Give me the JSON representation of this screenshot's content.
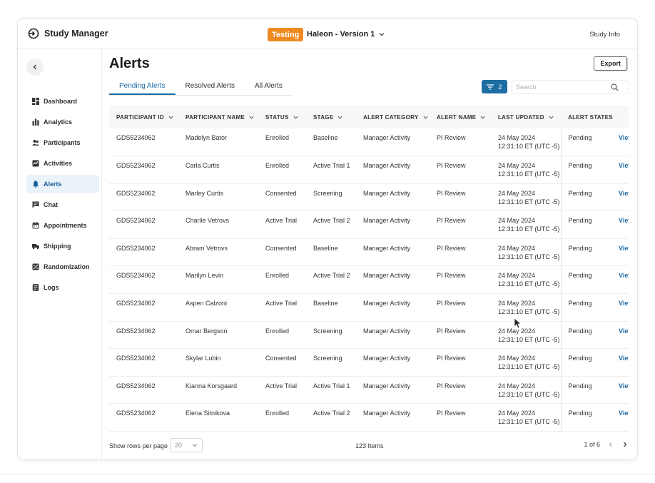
{
  "app": {
    "title": "Study Manager",
    "env_badge": "Testing",
    "study_name": "Haleon - Version 1",
    "study_info": "Study Info"
  },
  "sidebar": {
    "items": [
      {
        "label": "Dashboard",
        "icon": "dashboard-icon"
      },
      {
        "label": "Analytics",
        "icon": "analytics-icon"
      },
      {
        "label": "Participants",
        "icon": "participants-icon"
      },
      {
        "label": "Activities",
        "icon": "activities-icon"
      },
      {
        "label": "Alerts",
        "icon": "bell-icon",
        "active": true
      },
      {
        "label": "Chat",
        "icon": "chat-icon"
      },
      {
        "label": "Appointments",
        "icon": "calendar-icon"
      },
      {
        "label": "Shipping",
        "icon": "truck-icon"
      },
      {
        "label": "Randomization",
        "icon": "randomization-icon"
      },
      {
        "label": "Logs",
        "icon": "logs-icon"
      }
    ]
  },
  "page": {
    "title": "Alerts",
    "export_label": "Export",
    "tabs": [
      "Pending Alerts",
      "Resolved Alerts",
      "All Alerts"
    ],
    "active_tab": 0,
    "filter_count": "2",
    "search_placeholder": "Search"
  },
  "table": {
    "columns": [
      "PARTICIPANT ID",
      "PARTICIPANT NAME",
      "STATUS",
      "STAGE",
      "ALERT CATEGORY",
      "ALERT NAME",
      "LAST UPDATED",
      "ALERT STATES"
    ],
    "rows": [
      {
        "id": "GDS5234062",
        "name": "Madelyn Bator",
        "status": "Enrolled",
        "stage": "Baseline",
        "category": "Manager Activity",
        "alert": "PI Review",
        "date": "24 May 2024",
        "time": "12:31:10 ET (UTC -5)",
        "state": "Pending",
        "action": "View"
      },
      {
        "id": "GDS5234062",
        "name": "Carla Curtis",
        "status": "Enrolled",
        "stage": "Active Trial 1",
        "category": "Manager Activity",
        "alert": "PI Review",
        "date": "24 May 2024",
        "time": "12:31:10 ET (UTC -5)",
        "state": "Pending",
        "action": "View"
      },
      {
        "id": "GDS5234062",
        "name": "Marley Curtis",
        "status": "Consented",
        "stage": "Screening",
        "category": "Manager Activity",
        "alert": "PI Review",
        "date": "24 May 2024",
        "time": "12:31:10 ET (UTC -5)",
        "state": "Pending",
        "action": "View"
      },
      {
        "id": "GDS5234062",
        "name": "Charlie Vetrovs",
        "status": "Active Trial",
        "stage": "Active Trial 2",
        "category": "Manager Activity",
        "alert": "PI Review",
        "date": "24 May 2024",
        "time": "12:31:10 ET (UTC -5)",
        "state": "Pending",
        "action": "View"
      },
      {
        "id": "GDS5234062",
        "name": "Abram Vetrovs",
        "status": "Consented",
        "stage": "Baseline",
        "category": "Manager Activity",
        "alert": "PI Review",
        "date": "24 May 2024",
        "time": "12:31:10 ET (UTC -5)",
        "state": "Pending",
        "action": "View"
      },
      {
        "id": "GDS5234062",
        "name": "Marilyn Levin",
        "status": "Enrolled",
        "stage": "Active Trial 2",
        "category": "Manager Activity",
        "alert": "PI Review",
        "date": "24 May 2024",
        "time": "12:31:10 ET (UTC -5)",
        "state": "Pending",
        "action": "View"
      },
      {
        "id": "GDS5234062",
        "name": "Aspen Calzoni",
        "status": "Active Trial",
        "stage": "Baseline",
        "category": "Manager Activity",
        "alert": "PI Review",
        "date": "24 May 2024",
        "time": "12:31:10 ET (UTC -5)",
        "state": "Pending",
        "action": "View"
      },
      {
        "id": "GDS5234062",
        "name": "Omar Bergson",
        "status": "Enrolled",
        "stage": "Screening",
        "category": "Manager Activity",
        "alert": "PI Review",
        "date": "24 May 2024",
        "time": "12:31:10 ET (UTC -5)",
        "state": "Pending",
        "action": "View"
      },
      {
        "id": "GDS5234062",
        "name": "Skylar Lubin",
        "status": "Consented",
        "stage": "Screening",
        "category": "Manager Activity",
        "alert": "PI Review",
        "date": "24 May 2024",
        "time": "12:31:10 ET (UTC -5)",
        "state": "Pending",
        "action": "View"
      },
      {
        "id": "GDS5234062",
        "name": "Kianna Korsgaard",
        "status": "Active Trial",
        "stage": "Active Trial 1",
        "category": "Manager Activity",
        "alert": "PI Review",
        "date": "24 May 2024",
        "time": "12:31:10 ET (UTC -5)",
        "state": "Pending",
        "action": "View"
      },
      {
        "id": "GDS5234062",
        "name": "Elena Sitnikova",
        "status": "Enrolled",
        "stage": "Active Trial 2",
        "category": "Manager Activity",
        "alert": "PI Review",
        "date": "24 May 2024",
        "time": "12:31:10 ET (UTC -5)",
        "state": "Pending",
        "action": "View"
      }
    ]
  },
  "footer": {
    "rows_label": "Show rows per page",
    "rows_value": "20",
    "total": "123 Items",
    "page_info": "1 of 6"
  },
  "colors": {
    "accent": "#1c6aa6",
    "badge": "#ee8a1f",
    "filter": "#1d6ea3"
  }
}
